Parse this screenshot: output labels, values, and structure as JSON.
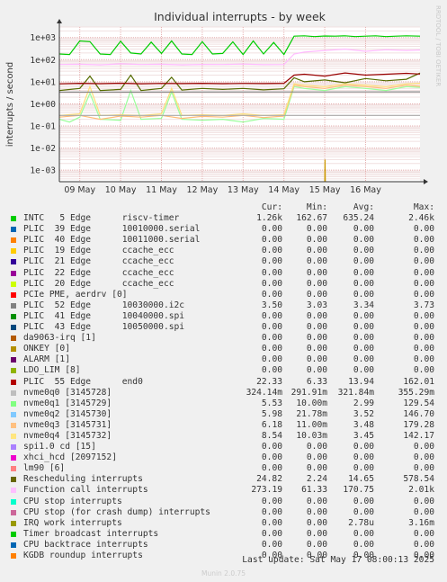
{
  "chart_data": {
    "type": "line",
    "title": "Individual interrupts - by week",
    "ylabel": "interrupts / second",
    "yscale": "log",
    "ylim": [
      0.0003,
      3000
    ],
    "yticks": [
      {
        "v": 1000,
        "label": "1e+03"
      },
      {
        "v": 100,
        "label": "1e+02"
      },
      {
        "v": 10,
        "label": "1e+01"
      },
      {
        "v": 1,
        "label": "1e+00"
      },
      {
        "v": 0.1,
        "label": "1e-01"
      },
      {
        "v": 0.01,
        "label": "1e-02"
      },
      {
        "v": 0.001,
        "label": "1e-03"
      }
    ],
    "xlim": [
      "2025-05-08T12:00",
      "2025-05-17T08:00"
    ],
    "xticks": [
      {
        "t": "2025-05-09T00:00",
        "label": "09 May"
      },
      {
        "t": "2025-05-10T00:00",
        "label": "10 May"
      },
      {
        "t": "2025-05-11T00:00",
        "label": "11 May"
      },
      {
        "t": "2025-05-12T00:00",
        "label": "12 May"
      },
      {
        "t": "2025-05-13T00:00",
        "label": "13 May"
      },
      {
        "t": "2025-05-14T00:00",
        "label": "14 May"
      },
      {
        "t": "2025-05-15T00:00",
        "label": "15 May"
      },
      {
        "t": "2025-05-16T00:00",
        "label": "16 May"
      }
    ],
    "grid": true,
    "watermark": "RRDTOOL / TOBI OETIKER",
    "series": [
      {
        "name": "INTC   5 Edge      riscv-timer",
        "color": "#00cc00",
        "draw": true,
        "x": [
          "2025-05-08T12:00",
          "2025-05-08T18:00",
          "2025-05-09T00:00",
          "2025-05-09T06:00",
          "2025-05-09T12:00",
          "2025-05-09T18:00",
          "2025-05-10T00:00",
          "2025-05-10T06:00",
          "2025-05-10T12:00",
          "2025-05-10T18:00",
          "2025-05-11T00:00",
          "2025-05-11T06:00",
          "2025-05-11T12:00",
          "2025-05-11T18:00",
          "2025-05-12T00:00",
          "2025-05-12T06:00",
          "2025-05-12T12:00",
          "2025-05-12T18:00",
          "2025-05-13T00:00",
          "2025-05-13T06:00",
          "2025-05-13T12:00",
          "2025-05-13T18:00",
          "2025-05-14T00:00",
          "2025-05-14T06:00",
          "2025-05-14T12:00",
          "2025-05-14T18:00",
          "2025-05-15T00:00",
          "2025-05-15T06:00",
          "2025-05-15T12:00",
          "2025-05-15T18:00",
          "2025-05-16T00:00",
          "2025-05-16T06:00",
          "2025-05-16T12:00",
          "2025-05-16T18:00",
          "2025-05-17T00:00",
          "2025-05-17T08:00"
        ],
        "y": [
          180,
          170,
          700,
          650,
          180,
          170,
          680,
          200,
          180,
          620,
          190,
          700,
          180,
          170,
          650,
          180,
          190,
          640,
          170,
          700,
          180,
          600,
          170,
          1150,
          1200,
          1100,
          1180,
          1150,
          1200,
          1100,
          1150,
          1200,
          1100,
          1150,
          1200,
          1150
        ]
      },
      {
        "name": "Function call interrupts",
        "color": "#ffbbff",
        "draw": true,
        "x": [
          "2025-05-08T12:00",
          "2025-05-09T00:00",
          "2025-05-09T12:00",
          "2025-05-10T00:00",
          "2025-05-10T12:00",
          "2025-05-11T00:00",
          "2025-05-11T12:00",
          "2025-05-12T00:00",
          "2025-05-12T12:00",
          "2025-05-13T00:00",
          "2025-05-13T12:00",
          "2025-05-14T00:00",
          "2025-05-14T06:00",
          "2025-05-14T12:00",
          "2025-05-15T00:00",
          "2025-05-15T12:00",
          "2025-05-16T00:00",
          "2025-05-16T12:00",
          "2025-05-17T00:00",
          "2025-05-17T08:00"
        ],
        "y": [
          60,
          62,
          58,
          65,
          60,
          62,
          58,
          61,
          60,
          63,
          59,
          60,
          180,
          220,
          260,
          300,
          240,
          280,
          260,
          273
        ]
      },
      {
        "name": "Rescheduling interrupts",
        "color": "#556b00",
        "draw": true,
        "x": [
          "2025-05-08T12:00",
          "2025-05-09T00:00",
          "2025-05-09T06:00",
          "2025-05-09T12:00",
          "2025-05-10T00:00",
          "2025-05-10T06:00",
          "2025-05-10T12:00",
          "2025-05-11T00:00",
          "2025-05-11T06:00",
          "2025-05-11T12:00",
          "2025-05-12T00:00",
          "2025-05-12T12:00",
          "2025-05-13T00:00",
          "2025-05-13T12:00",
          "2025-05-14T00:00",
          "2025-05-14T06:00",
          "2025-05-14T12:00",
          "2025-05-15T00:00",
          "2025-05-15T12:00",
          "2025-05-16T00:00",
          "2025-05-16T12:00",
          "2025-05-17T00:00",
          "2025-05-17T08:00"
        ],
        "y": [
          4,
          5,
          18,
          4,
          4.5,
          20,
          4,
          5,
          16,
          4.2,
          5,
          4.5,
          5,
          4.3,
          4.8,
          15,
          10,
          12,
          9,
          14,
          11,
          13,
          24.8
        ]
      },
      {
        "name": "PLIC  55 Edge      end0",
        "color": "#990000",
        "draw": true,
        "x": [
          "2025-05-08T12:00",
          "2025-05-09T00:00",
          "2025-05-09T12:00",
          "2025-05-10T00:00",
          "2025-05-10T12:00",
          "2025-05-11T00:00",
          "2025-05-11T12:00",
          "2025-05-12T00:00",
          "2025-05-12T12:00",
          "2025-05-13T00:00",
          "2025-05-13T12:00",
          "2025-05-14T00:00",
          "2025-05-14T06:00",
          "2025-05-14T12:00",
          "2025-05-15T00:00",
          "2025-05-15T12:00",
          "2025-05-16T00:00",
          "2025-05-16T12:00",
          "2025-05-17T00:00",
          "2025-05-17T08:00"
        ],
        "y": [
          8,
          8.5,
          8.2,
          8.6,
          8.1,
          8.4,
          8.3,
          8.5,
          8.2,
          8.4,
          8.3,
          8.5,
          20,
          22,
          18,
          25,
          20,
          22,
          24,
          22.3
        ]
      },
      {
        "name": "nvme0q1 [3145729]",
        "color": "#99ff99",
        "draw": true,
        "x": [
          "2025-05-08T12:00",
          "2025-05-08T18:00",
          "2025-05-09T00:00",
          "2025-05-09T06:00",
          "2025-05-09T12:00",
          "2025-05-10T00:00",
          "2025-05-10T06:00",
          "2025-05-10T12:00",
          "2025-05-11T00:00",
          "2025-05-11T06:00",
          "2025-05-11T12:00",
          "2025-05-12T00:00",
          "2025-05-12T12:00",
          "2025-05-13T00:00",
          "2025-05-13T12:00",
          "2025-05-14T00:00",
          "2025-05-14T06:00",
          "2025-05-14T12:00",
          "2025-05-15T00:00",
          "2025-05-15T12:00",
          "2025-05-16T00:00",
          "2025-05-16T12:00",
          "2025-05-17T00:00",
          "2025-05-17T08:00"
        ],
        "y": [
          0.2,
          0.15,
          0.25,
          3,
          0.2,
          0.18,
          4,
          0.2,
          0.22,
          3.5,
          0.2,
          0.18,
          0.2,
          0.15,
          0.22,
          0.2,
          6,
          5,
          4,
          6,
          5,
          4,
          6,
          5.5
        ]
      },
      {
        "name": "nvme0q3 [3145731]",
        "color": "#ffbb77",
        "draw": true,
        "x": [
          "2025-05-08T12:00",
          "2025-05-09T00:00",
          "2025-05-09T12:00",
          "2025-05-10T00:00",
          "2025-05-10T12:00",
          "2025-05-11T00:00",
          "2025-05-11T12:00",
          "2025-05-12T00:00",
          "2025-05-12T12:00",
          "2025-05-13T00:00",
          "2025-05-13T12:00",
          "2025-05-14T00:00",
          "2025-05-14T06:00",
          "2025-05-14T12:00",
          "2025-05-15T00:00",
          "2025-05-15T12:00",
          "2025-05-16T00:00",
          "2025-05-16T12:00",
          "2025-05-17T00:00",
          "2025-05-17T08:00"
        ],
        "y": [
          0.25,
          0.3,
          0.2,
          0.28,
          0.25,
          0.3,
          0.22,
          0.27,
          0.25,
          0.3,
          0.24,
          0.28,
          7,
          6,
          5,
          7,
          6,
          5,
          7,
          6.2
        ]
      },
      {
        "name": "nvme0q4 [3145732]",
        "color": "#ffe077",
        "draw": true,
        "x": [
          "2025-05-08T12:00",
          "2025-05-09T00:00",
          "2025-05-09T06:00",
          "2025-05-09T12:00",
          "2025-05-10T00:00",
          "2025-05-10T12:00",
          "2025-05-11T00:00",
          "2025-05-11T06:00",
          "2025-05-11T12:00",
          "2025-05-12T00:00",
          "2025-05-12T12:00",
          "2025-05-13T00:00",
          "2025-05-13T12:00",
          "2025-05-14T00:00",
          "2025-05-14T06:00",
          "2025-05-14T12:00",
          "2025-05-15T00:00",
          "2025-05-15T12:00",
          "2025-05-16T00:00",
          "2025-05-16T12:00",
          "2025-05-17T00:00",
          "2025-05-17T08:00"
        ],
        "y": [
          0.3,
          0.35,
          6,
          0.3,
          0.32,
          0.3,
          0.35,
          5,
          0.3,
          0.32,
          0.3,
          0.35,
          0.3,
          0.32,
          8,
          7,
          6,
          8,
          7,
          6,
          8,
          8.5
        ]
      },
      {
        "name": "nvme0q0 [3145728]",
        "color": "#aaaaaa",
        "draw": true,
        "x": [
          "2025-05-08T12:00",
          "2025-05-17T08:00"
        ],
        "y": [
          0.3,
          0.3
        ]
      },
      {
        "name": "PLIC  52 Edge      10030000.i2c",
        "color": "#888888",
        "draw": true,
        "x": [
          "2025-05-08T12:00",
          "2025-05-17T08:00"
        ],
        "y": [
          3.4,
          3.5
        ]
      },
      {
        "name": "IRQ work interrupts",
        "color": "#cc9900",
        "draw": true,
        "x": [
          "2025-05-15T00:00",
          "2025-05-15T00:10",
          "2025-05-15T00:20"
        ],
        "y": [
          0.0003,
          0.003,
          0.0003
        ]
      }
    ]
  },
  "legend": {
    "headers": {
      "cur": "Cur:",
      "min": "Min:",
      "avg": "Avg:",
      "max": "Max:"
    },
    "rows": [
      {
        "name": "INTC   5 Edge      riscv-timer",
        "color": "#00cc00",
        "cur": "1.26k",
        "min": "162.67",
        "avg": "635.24",
        "max": "2.46k"
      },
      {
        "name": "PLIC  39 Edge      10010000.serial",
        "color": "#0066b3",
        "cur": "0.00",
        "min": "0.00",
        "avg": "0.00",
        "max": "0.00"
      },
      {
        "name": "PLIC  40 Edge      10011000.serial",
        "color": "#ff8000",
        "cur": "0.00",
        "min": "0.00",
        "avg": "0.00",
        "max": "0.00"
      },
      {
        "name": "PLIC  19 Edge      ccache_ecc",
        "color": "#ffcc00",
        "cur": "0.00",
        "min": "0.00",
        "avg": "0.00",
        "max": "0.00"
      },
      {
        "name": "PLIC  21 Edge      ccache_ecc",
        "color": "#330099",
        "cur": "0.00",
        "min": "0.00",
        "avg": "0.00",
        "max": "0.00"
      },
      {
        "name": "PLIC  22 Edge      ccache_ecc",
        "color": "#990099",
        "cur": "0.00",
        "min": "0.00",
        "avg": "0.00",
        "max": "0.00"
      },
      {
        "name": "PLIC  20 Edge      ccache_ecc",
        "color": "#ccff00",
        "cur": "0.00",
        "min": "0.00",
        "avg": "0.00",
        "max": "0.00"
      },
      {
        "name": "PCIe PME, aerdrv [0]",
        "color": "#ff0000",
        "cur": "0.00",
        "min": "0.00",
        "avg": "0.00",
        "max": "0.00"
      },
      {
        "name": "PLIC  52 Edge      10030000.i2c",
        "color": "#808080",
        "cur": "3.50",
        "min": "3.03",
        "avg": "3.34",
        "max": "3.73"
      },
      {
        "name": "PLIC  41 Edge      10040000.spi",
        "color": "#008f00",
        "cur": "0.00",
        "min": "0.00",
        "avg": "0.00",
        "max": "0.00"
      },
      {
        "name": "PLIC  43 Edge      10050000.spi",
        "color": "#00487d",
        "cur": "0.00",
        "min": "0.00",
        "avg": "0.00",
        "max": "0.00"
      },
      {
        "name": "da9063-irq [1]",
        "color": "#b35a00",
        "cur": "0.00",
        "min": "0.00",
        "avg": "0.00",
        "max": "0.00"
      },
      {
        "name": "ONKEY [0]",
        "color": "#b38f00",
        "cur": "0.00",
        "min": "0.00",
        "avg": "0.00",
        "max": "0.00"
      },
      {
        "name": "ALARM [1]",
        "color": "#6b006b",
        "cur": "0.00",
        "min": "0.00",
        "avg": "0.00",
        "max": "0.00"
      },
      {
        "name": "LDO_LIM [8]",
        "color": "#8fb300",
        "cur": "0.00",
        "min": "0.00",
        "avg": "0.00",
        "max": "0.00"
      },
      {
        "name": "PLIC  55 Edge      end0",
        "color": "#b30000",
        "cur": "22.33",
        "min": "6.33",
        "avg": "13.94",
        "max": "162.01"
      },
      {
        "name": "nvme0q0 [3145728]",
        "color": "#bebebe",
        "cur": "324.14m",
        "min": "291.91m",
        "avg": "321.84m",
        "max": "355.29m"
      },
      {
        "name": "nvme0q1 [3145729]",
        "color": "#80ff80",
        "cur": "5.53",
        "min": "10.00m",
        "avg": "2.99",
        "max": "129.54"
      },
      {
        "name": "nvme0q2 [3145730]",
        "color": "#80c9ff",
        "cur": "5.98",
        "min": "21.78m",
        "avg": "3.52",
        "max": "146.70"
      },
      {
        "name": "nvme0q3 [3145731]",
        "color": "#ffc080",
        "cur": "6.18",
        "min": "11.00m",
        "avg": "3.48",
        "max": "179.28"
      },
      {
        "name": "nvme0q4 [3145732]",
        "color": "#ffe680",
        "cur": "8.54",
        "min": "10.03m",
        "avg": "3.45",
        "max": "142.17"
      },
      {
        "name": "spi1.0 cd [15]",
        "color": "#aa80ff",
        "cur": "0.00",
        "min": "0.00",
        "avg": "0.00",
        "max": "0.00"
      },
      {
        "name": "xhci_hcd [2097152]",
        "color": "#ee00cc",
        "cur": "0.00",
        "min": "0.00",
        "avg": "0.00",
        "max": "0.00"
      },
      {
        "name": "lm90 [6]",
        "color": "#ff8080",
        "cur": "0.00",
        "min": "0.00",
        "avg": "0.00",
        "max": "0.00"
      },
      {
        "name": "Rescheduling interrupts",
        "color": "#666600",
        "cur": "24.82",
        "min": "2.24",
        "avg": "14.65",
        "max": "578.54"
      },
      {
        "name": "Function call interrupts",
        "color": "#ffbfff",
        "cur": "273.19",
        "min": "61.33",
        "avg": "170.75",
        "max": "2.01k"
      },
      {
        "name": "CPU stop interrupts",
        "color": "#00ffcc",
        "cur": "0.00",
        "min": "0.00",
        "avg": "0.00",
        "max": "0.00"
      },
      {
        "name": "CPU stop (for crash dump) interrupts",
        "color": "#cc6699",
        "cur": "0.00",
        "min": "0.00",
        "avg": "0.00",
        "max": "0.00"
      },
      {
        "name": "IRQ work interrupts",
        "color": "#999900",
        "cur": "0.00",
        "min": "0.00",
        "avg": "2.78u",
        "max": "3.16m"
      },
      {
        "name": "Timer broadcast interrupts",
        "color": "#00cc00",
        "cur": "0.00",
        "min": "0.00",
        "avg": "0.00",
        "max": "0.00"
      },
      {
        "name": "CPU backtrace interrupts",
        "color": "#0066b3",
        "cur": "0.00",
        "min": "0.00",
        "avg": "0.00",
        "max": "0.00"
      },
      {
        "name": "KGDB roundup interrupts",
        "color": "#ff8000",
        "cur": "0.00",
        "min": "0.00",
        "avg": "0.00",
        "max": "0.00"
      }
    ]
  },
  "last_update": "Last update: Sat May 17 08:00:13 2025",
  "footer": "Munin 2.0.75"
}
